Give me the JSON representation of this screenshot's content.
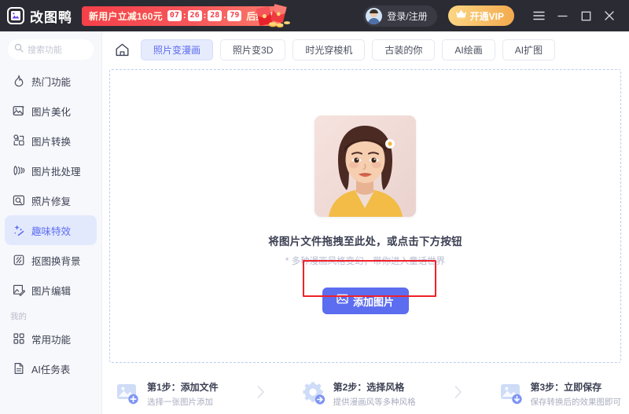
{
  "titlebar": {
    "logo_text": "改图鸭",
    "logo_icon": "app-logo-icon",
    "promo": {
      "text": "新用户立减160元",
      "hours": "07",
      "minutes": "26",
      "seconds": "28",
      "centis": "79",
      "sep1": ":",
      "sep2": ":",
      "sep3": ".",
      "tail": "后结束"
    },
    "account_label": "登录/注册",
    "vip_label": "开通VIP",
    "menu_icon": "hamburger-menu-icon",
    "minimize_icon": "minimize-icon",
    "maximize_icon": "maximize-icon",
    "close_icon": "close-icon"
  },
  "sidebar": {
    "search_placeholder": "搜索功能",
    "items": [
      {
        "label": "热门功能",
        "icon": "flame-icon",
        "active": false
      },
      {
        "label": "图片美化",
        "icon": "image-sparkle-icon",
        "active": false
      },
      {
        "label": "图片转换",
        "icon": "convert-icon",
        "active": false
      },
      {
        "label": "图片批处理",
        "icon": "batch-icon",
        "active": false
      },
      {
        "label": "照片修复",
        "icon": "photo-repair-icon",
        "active": false
      },
      {
        "label": "趣味特效",
        "icon": "magic-wand-icon",
        "active": true
      },
      {
        "label": "抠图换背景",
        "icon": "cutout-icon",
        "active": false
      },
      {
        "label": "图片编辑",
        "icon": "edit-image-icon",
        "active": false
      }
    ],
    "section_label": "我的",
    "my_items": [
      {
        "label": "常用功能",
        "icon": "grid-icon"
      },
      {
        "label": "AI任务表",
        "icon": "document-icon"
      }
    ]
  },
  "main": {
    "home_icon": "home-icon",
    "tabs": [
      {
        "label": "照片变漫画",
        "active": true
      },
      {
        "label": "照片变3D",
        "active": false
      },
      {
        "label": "时光穿梭机",
        "active": false
      },
      {
        "label": "古装的你",
        "active": false
      },
      {
        "label": "AI绘画",
        "active": false
      },
      {
        "label": "AI扩图",
        "active": false
      }
    ],
    "dropzone": {
      "thumbnail_alt": "portrait-photo-thumbnail",
      "title": "将图片文件拖拽至此处，或点击下方按钮",
      "subtitle": "* 多种漫画风格变幻，带你进入童话世界",
      "add_button_label": "添加图片",
      "add_button_icon": "picture-icon",
      "annotation": "red-highlight-box"
    },
    "steps": [
      {
        "title": "第1步：添加文件",
        "sub": "选择一张图片添加",
        "icon": "add-picture-step-icon"
      },
      {
        "title": "第2步：选择风格",
        "sub": "提供漫画风等多种风格",
        "icon": "gear-step-icon"
      },
      {
        "title": "第3步：立即保存",
        "sub": "保存转换后的效果图即可",
        "icon": "save-picture-step-icon"
      }
    ],
    "step_arrow_icon": "chevron-right-icon"
  },
  "colors": {
    "accent": "#5c6df0",
    "accent_soft": "#e6ebfd",
    "titlebar_bg": "#2b2b33",
    "promo_red": "#f5404a",
    "vip_gold": "#f3aa4e",
    "annotation_red": "#f0212a",
    "sidebar_bg": "#f7f8fc"
  }
}
